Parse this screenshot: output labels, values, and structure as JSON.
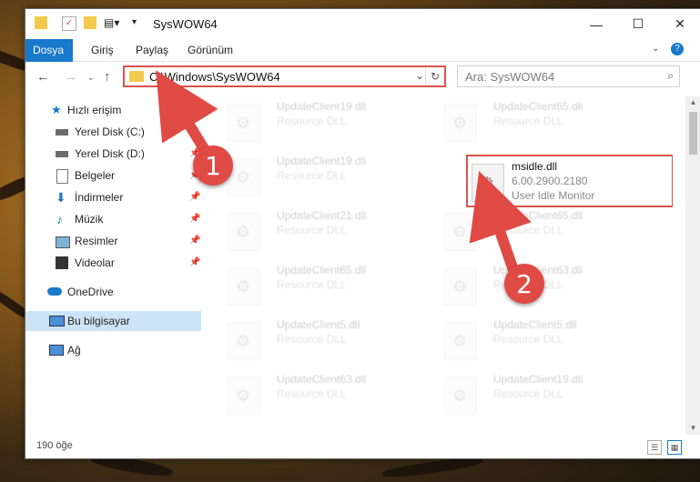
{
  "window": {
    "title": "SysWOW64"
  },
  "ribbon": {
    "tabs": [
      "Dosya",
      "Giriş",
      "Paylaş",
      "Görünüm"
    ]
  },
  "navbar": {
    "path": "C:\\Windows\\SysWOW64",
    "search_placeholder": "Ara: SysWOW64"
  },
  "sidebar": {
    "items": [
      {
        "label": "Hızlı erişim",
        "icon": "star-icon",
        "pinned": false
      },
      {
        "label": "Yerel Disk (C:)",
        "icon": "drive-icon",
        "pinned": false
      },
      {
        "label": "Yerel Disk (D:)",
        "icon": "drive-icon",
        "pinned": true
      },
      {
        "label": "Belgeler",
        "icon": "documents-icon",
        "pinned": true
      },
      {
        "label": "İndirmeler",
        "icon": "download-icon",
        "pinned": true
      },
      {
        "label": "Müzik",
        "icon": "music-icon",
        "pinned": true
      },
      {
        "label": "Resimler",
        "icon": "pictures-icon",
        "pinned": true
      },
      {
        "label": "Videolar",
        "icon": "videos-icon",
        "pinned": true
      },
      {
        "label": "OneDrive",
        "icon": "cloud-icon",
        "pinned": false
      },
      {
        "label": "Bu bilgisayar",
        "icon": "computer-icon",
        "pinned": false,
        "selected": true
      },
      {
        "label": "Ağ",
        "icon": "network-icon",
        "pinned": false
      }
    ]
  },
  "files": {
    "left": [
      {
        "name": "UpdateClient19.dll",
        "type": "Resource DLL"
      },
      {
        "name": "UpdateClient19.dll",
        "type": "Resource DLL"
      },
      {
        "name": "UpdateClient21.dll",
        "type": "Resource DLL"
      },
      {
        "name": "UpdateClient65.dll",
        "type": "Resource DLL"
      },
      {
        "name": "UpdateClient5.dll",
        "type": "Resource DLL"
      },
      {
        "name": "UpdateClient63.dll",
        "type": "Resource DLL"
      }
    ],
    "right": [
      {
        "name": "UpdateClient65.dll",
        "type": "Resource DLL"
      },
      {
        "name": "UpdateClient65.dll",
        "type": "Resource DLL"
      },
      {
        "name": "UpdateClient63.dll",
        "type": "Resource DLL"
      },
      {
        "name": "UpdateClient5.dll",
        "type": "Resource DLL"
      },
      {
        "name": "UpdateClient19.dll",
        "type": "Resource DLL"
      }
    ],
    "highlighted": {
      "name": "msidle.dll",
      "version": "6.00.2900.2180",
      "description": "User Idle Monitor"
    }
  },
  "status": {
    "count": "190 öğe"
  },
  "annotations": {
    "step1": "1",
    "step2": "2",
    "color": "#e04a45"
  }
}
